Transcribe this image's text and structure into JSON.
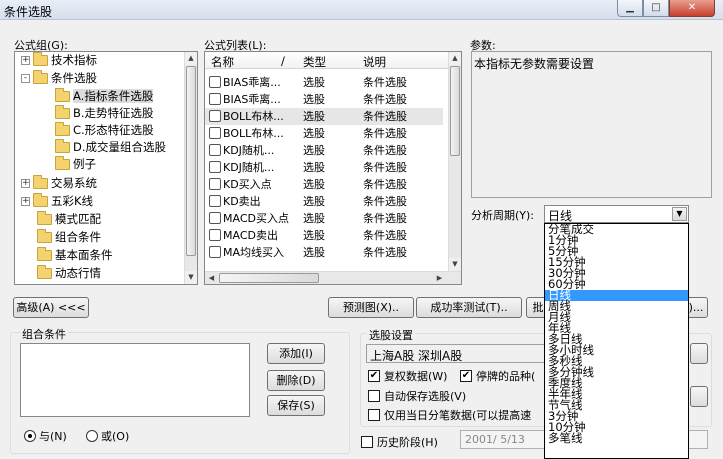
{
  "window": {
    "title": "条件选股"
  },
  "formula_group": {
    "label": "公式组(G):",
    "items": [
      {
        "label": "技术指标",
        "tog": "+"
      },
      {
        "label": "条件选股",
        "tog": "-"
      },
      {
        "label": "A.指标条件选股"
      },
      {
        "label": "B.走势特征选股"
      },
      {
        "label": "C.形态特征选股"
      },
      {
        "label": "D.成交量组合选股"
      },
      {
        "label": "例子"
      },
      {
        "label": "交易系统",
        "tog": "+"
      },
      {
        "label": "五彩K线",
        "tog": "+"
      },
      {
        "label": "模式匹配"
      },
      {
        "label": "组合条件"
      },
      {
        "label": "基本面条件"
      },
      {
        "label": "动态行情"
      }
    ]
  },
  "formula_list": {
    "label": "公式列表(L):",
    "columns": [
      "名称",
      "/",
      "类型",
      "说明"
    ],
    "rows": [
      {
        "name": "BIAS乖离...",
        "type": "选股",
        "desc": "条件选股"
      },
      {
        "name": "BIAS乖离...",
        "type": "选股",
        "desc": "条件选股"
      },
      {
        "name": "BOLL布林...",
        "type": "选股",
        "desc": "条件选股"
      },
      {
        "name": "BOLL布林...",
        "type": "选股",
        "desc": "条件选股"
      },
      {
        "name": "KDJ随机...",
        "type": "选股",
        "desc": "条件选股"
      },
      {
        "name": "KDJ随机...",
        "type": "选股",
        "desc": "条件选股"
      },
      {
        "name": "KD买入点",
        "type": "选股",
        "desc": "条件选股"
      },
      {
        "name": "KD卖出",
        "type": "选股",
        "desc": "条件选股"
      },
      {
        "name": "MACD买入点",
        "type": "选股",
        "desc": "条件选股"
      },
      {
        "name": "MACD卖出",
        "type": "选股",
        "desc": "条件选股"
      },
      {
        "name": "MA均线买入",
        "type": "选股",
        "desc": "条件选股"
      }
    ]
  },
  "params": {
    "label": "参数:",
    "text": "本指标无参数需要设置"
  },
  "period": {
    "label": "分析周期(Y):",
    "value": "日线",
    "options": [
      "分笔成交",
      "1分钟",
      "5分钟",
      "15分钟",
      "30分钟",
      "60分钟",
      "日线",
      "周线",
      "月线",
      "年线",
      "多日线",
      "多小时线",
      "多秒线",
      "多分钟线",
      "季度线",
      "半年线",
      "节气线",
      "3分钟",
      "10分钟",
      "多笔线"
    ],
    "selected_index": 6
  },
  "buttons": {
    "advanced": "高级(A) <<<",
    "preview": "预测图(X)..",
    "success_test": "成功率测试(T)..",
    "partial": "批",
    "partial_right": ")...",
    "add": "添加(I)",
    "delete": "删除(D)",
    "save": "保存(S)"
  },
  "combo": {
    "title": "组合条件",
    "radio_and": "与(N)",
    "radio_or": "或(O)"
  },
  "stock_settings": {
    "title": "选股设置",
    "markets": "上海A股  深圳A股",
    "options": [
      {
        "label": "复权数据(W)",
        "checked": true
      },
      {
        "label": "停牌的品种(",
        "checked": true
      },
      {
        "label": "自动保存选股(V)",
        "checked": false
      },
      {
        "label": "仅用当日分笔数据(可以提高速",
        "checked": false
      }
    ]
  },
  "history": {
    "label": "历史阶段(H)",
    "checked": false,
    "date": "2001/ 5/13"
  }
}
